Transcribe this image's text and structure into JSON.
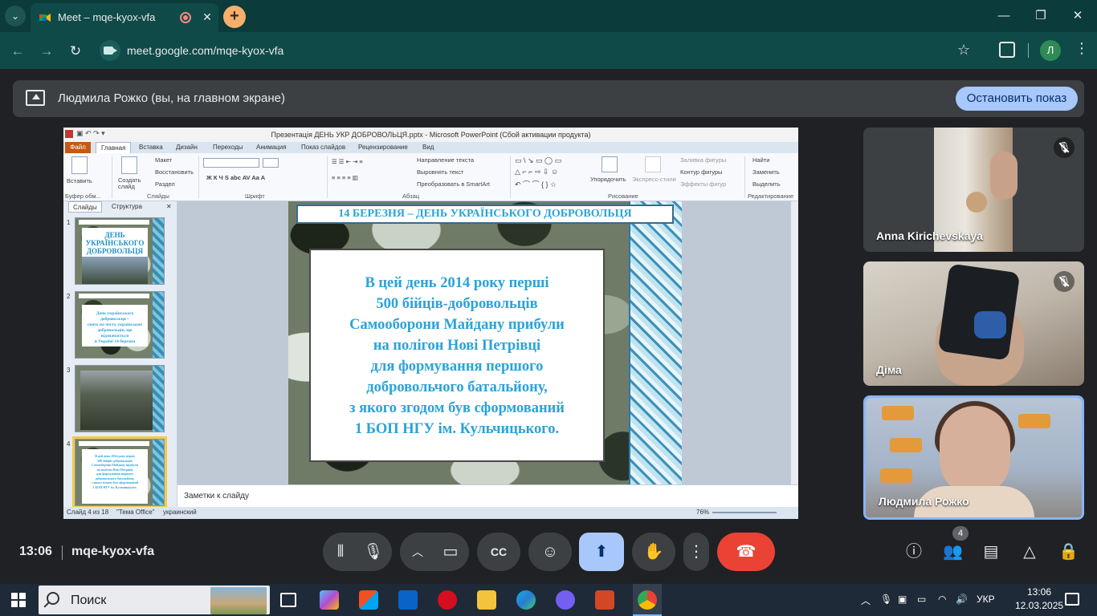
{
  "browser": {
    "tab_title": "Meet – mqe-kyox-vfa",
    "url": "meet.google.com/mqe-kyox-vfa",
    "profile_initial": "Л"
  },
  "meet": {
    "banner_text": "Людмила Рожко (вы, на главном экране)",
    "stop_button": "Остановить показ",
    "time": "13:06",
    "meeting_code": "mqe-kyox-vfa",
    "participants_count": "4",
    "participants": [
      {
        "name": "Anna Kirichevskaya",
        "muted": true
      },
      {
        "name": "Діма",
        "muted": true
      },
      {
        "name": "Людмила Рожко",
        "muted": false
      }
    ]
  },
  "powerpoint": {
    "window_title": "Презентація ДЕНЬ УКР ДОБРОВОЛЬЦЯ.pptx - Microsoft PowerPoint (Сбой активации продукта)",
    "ribbon_tabs": [
      "Файл",
      "Главная",
      "Вставка",
      "Дизайн",
      "Переходы",
      "Анимация",
      "Показ слайдов",
      "Рецензирование",
      "Вид"
    ],
    "ribbon": {
      "paste": "Вставить",
      "clipboard": "Буфер обм...",
      "layout": "Макет",
      "reset": "Восстановить",
      "section": "Раздел",
      "new_slide": "Создать слайд",
      "slides": "Слайды",
      "font": "Шрифт",
      "text_direction": "Направление текста",
      "align_text": "Выровнять текст",
      "smartart": "Преобразовать в SmartArt",
      "paragraph": "Абзац",
      "arrange": "Упорядочить",
      "quick_styles": "Экспресс-стили",
      "shape_fill": "Заливка фигуры",
      "shape_outline": "Контур фигуры",
      "shape_effects": "Эффекты фигур",
      "drawing": "Рисование",
      "find": "Найти",
      "replace": "Заменить",
      "select": "Выделить",
      "editing": "Редактирование"
    },
    "pane_tabs": [
      "Слайды",
      "Структура"
    ],
    "thumbnails": [
      {
        "num": "1",
        "lines": [
          "ДЕНЬ",
          "УКРАЇНСЬКОГО",
          "ДОБРОВОЛЬЦЯ"
        ]
      },
      {
        "num": "2",
        "lines": [
          "День українського добровольця –",
          "свято на честь українських",
          "добровольців, що відзначається",
          "в Україні 14 березня"
        ]
      },
      {
        "num": "3",
        "lines": []
      },
      {
        "num": "4",
        "lines": [
          "В цей день 2014 року перші",
          "500 бійців-добровольців",
          "Самооборони Майдану прибули",
          "на полігон Нові Петрівці",
          "для формування першого",
          "добровольчого батальйону,",
          "з якого згодом був сформований",
          "1 БОП НГУ ім. Кульчицького."
        ]
      }
    ],
    "slide_header": "14 БЕРЕЗНЯ – ДЕНЬ УКРАЇНСЬКОГО ДОБРОВОЛЬЦЯ",
    "slide_body": [
      "В цей день 2014 року перші",
      "500 бійців-добровольців",
      "Самооборони Майдану прибули",
      "на полігон Нові Петрівці",
      "для формування першого",
      "добровольчого батальйону,",
      "з якого згодом був сформований",
      "1 БОП НГУ ім. Кульчицького."
    ],
    "notes_placeholder": "Заметки к слайду",
    "status": {
      "slide": "Слайд 4 из 18",
      "theme": "\"Тема Office\"",
      "language": "украинский",
      "zoom": "76%"
    }
  },
  "taskbar": {
    "search": "Поиск",
    "lang": "УКР",
    "time": "13:06",
    "date": "12.03.2025"
  },
  "colors": {
    "accent": "#a8c7fa",
    "end_call": "#ea4335",
    "slide_text": "#2aa3d8"
  }
}
